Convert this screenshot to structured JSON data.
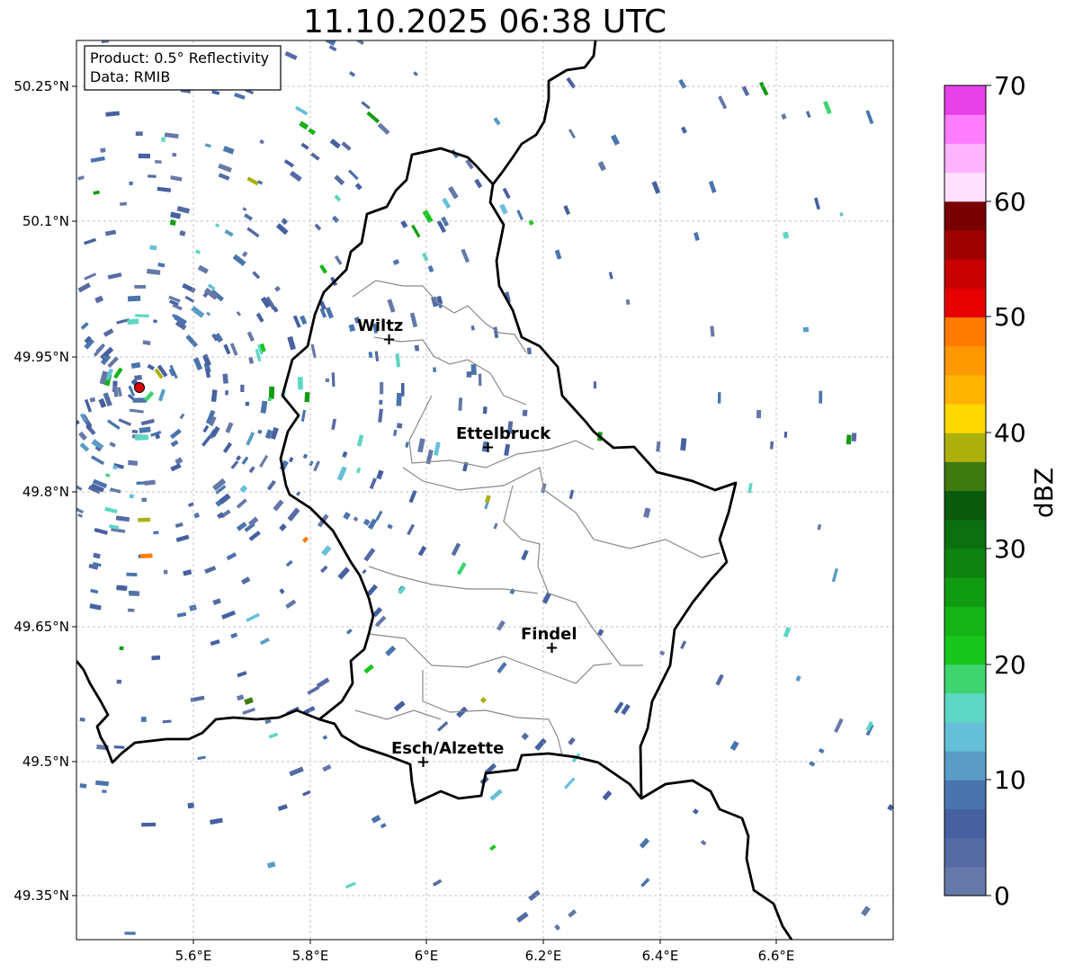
{
  "title": "11.10.2025 06:38 UTC",
  "info": {
    "product": "Product: 0.5° Reflectivity",
    "data": "Data: RMIB"
  },
  "colorbar": {
    "label": "dBZ",
    "ticks": [
      "0",
      "10",
      "20",
      "30",
      "40",
      "50",
      "60",
      "70"
    ],
    "colors": [
      "#6678a8",
      "#566aa3",
      "#4660a0",
      "#4a74ac",
      "#5a9cc6",
      "#66c0d8",
      "#5ed6c4",
      "#3ed470",
      "#18c61e",
      "#14b416",
      "#109c12",
      "#0e8410",
      "#0c7010",
      "#0a5a0c",
      "#3e7a10",
      "#acb00a",
      "#ffd800",
      "#ffb400",
      "#ff9800",
      "#ff7c00",
      "#e60000",
      "#c80000",
      "#a00000",
      "#780000",
      "#ffe0ff",
      "#ffb4ff",
      "#ff7cff",
      "#e840e8"
    ]
  },
  "axes": {
    "x_ticks": [
      "5.6°E",
      "5.8°E",
      "6°E",
      "6.2°E",
      "6.4°E",
      "6.6°E"
    ],
    "y_ticks": [
      "50.25°N",
      "50.1°N",
      "49.95°N",
      "49.8°N",
      "49.65°N",
      "49.5°N",
      "49.35°N"
    ]
  },
  "cities": [
    {
      "name": "Wiltz"
    },
    {
      "name": "Ettelbruck"
    },
    {
      "name": "Findel"
    },
    {
      "name": "Esch/Alzette"
    }
  ]
}
